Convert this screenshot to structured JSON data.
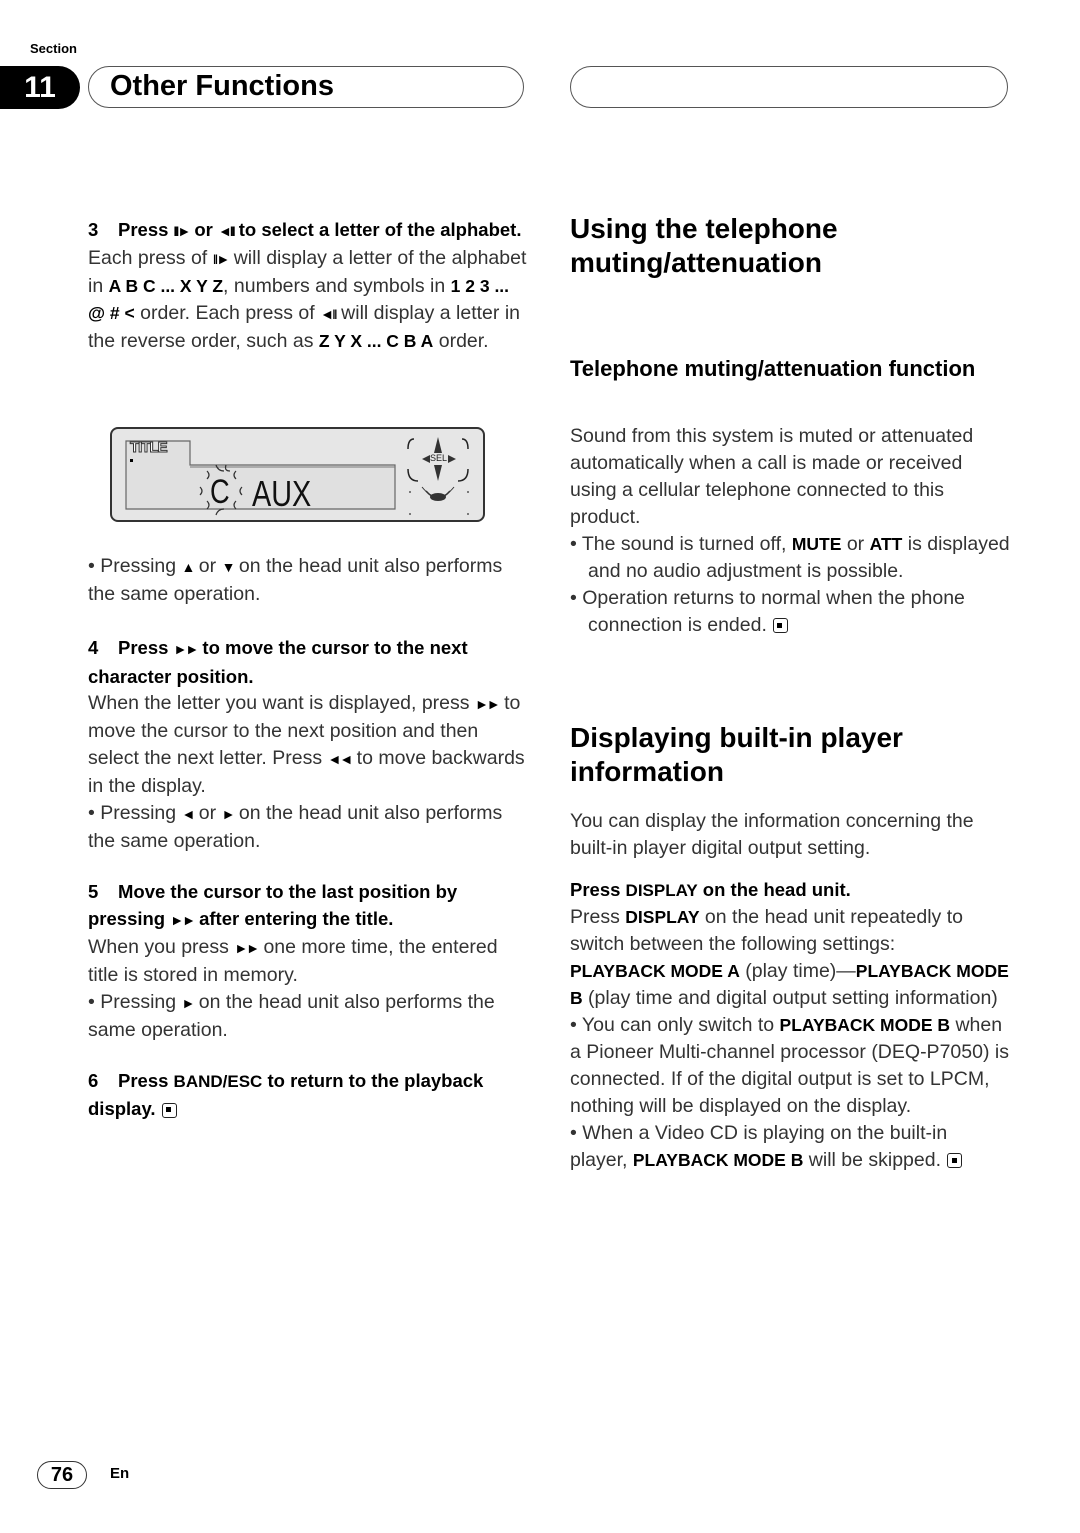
{
  "header": {
    "section_label": "Section",
    "section_number": "11",
    "section_title": "Other Functions"
  },
  "left": {
    "step3": {
      "num": "3",
      "title_a": "Press ",
      "glyph_next": "II►",
      "title_b": " or ",
      "glyph_prev": "◄II",
      "title_c": " to select a letter of the alphabet.",
      "body_1": "Each press of ",
      "body_2": " will display a letter of the alphabet in ",
      "body_bold_1": "A B C ... X Y Z",
      "body_3": ", numbers and symbols in ",
      "body_bold_2": "1 2 3 ... @ # <",
      "body_4": " order. Each press of ",
      "body_5": " will display a letter in the reverse order, such as ",
      "body_bold_3": "Z Y X ... C B A",
      "body_6": " order."
    },
    "lcd": {
      "title_tag": "TITLE",
      "blink_char": "C",
      "text": "AUX",
      "sel_label": "SEL"
    },
    "bullet_updown": {
      "a": "• Pressing ",
      "g1": "▲",
      "b": " or ",
      "g2": "▼",
      "c": " on the head unit also performs the same operation."
    },
    "step4": {
      "num": "4",
      "title_a": "Press ",
      "glyph_ff": "►►",
      "title_b": " to move the cursor to the next character position.",
      "body_1": "When the letter you want is displayed, press ",
      "body_2": " to move the cursor to the next position and then select the next letter. Press ",
      "glyph_rew": "◄◄",
      "body_3": " to move backwards in the display.",
      "bullet_a": "• Pressing ",
      "g_left": "◄",
      "bullet_b": " or ",
      "g_right": "►",
      "bullet_c": " on the head unit also performs the same operation."
    },
    "step5": {
      "num": "5",
      "title_a": "Move the cursor to the last position by pressing ",
      "title_b": " after entering the title.",
      "body_1": "When you press ",
      "body_2": " one more time, the entered title is stored in memory.",
      "bullet_a": "• Pressing ",
      "bullet_b": " on the head unit also performs the same operation."
    },
    "step6": {
      "num": "6",
      "title_a": "Press ",
      "key": "BAND/ESC",
      "title_b": " to return to the playback display."
    }
  },
  "right": {
    "h_tel": "Using the telephone muting/attenuation",
    "h_tel_func": "Telephone muting/attenuation function",
    "tel_body": "Sound from this system is muted or attenuated automatically when a call is made or received using a cellular telephone connected to this product.",
    "tel_b1_a": "• The sound is turned off, ",
    "tel_b1_mute": "MUTE",
    "tel_b1_b": " or ",
    "tel_b1_att": "ATT",
    "tel_b1_c": " is displayed and no audio adjustment is possible.",
    "tel_b2": "• Operation returns to normal when the phone connection is ended.",
    "h_disp": "Displaying built-in player information",
    "disp_body": "You can display the information concerning the built-in player digital output setting.",
    "disp_step_a": "Press ",
    "disp_key": "DISPLAY",
    "disp_step_b": " on the head unit.",
    "disp_p_a": "Press ",
    "disp_p_b": " on the head unit repeatedly to switch between the following settings:",
    "mode_a": "PLAYBACK MODE A",
    "mode_a_desc": " (play time)—",
    "mode_b": "PLAYBACK MODE B",
    "mode_b_desc": " (play time and digital output setting information)",
    "b1_a": "• You can only switch to ",
    "b1_b": " when a Pioneer Multi-channel processor (DEQ-P7050) is connected. If of the digital output is set to LPCM, nothing will be displayed on the display.",
    "b2_a": "• When a Video CD is playing on the built-in player, ",
    "b2_b": " will be skipped."
  },
  "footer": {
    "page_number": "76",
    "language": "En"
  }
}
